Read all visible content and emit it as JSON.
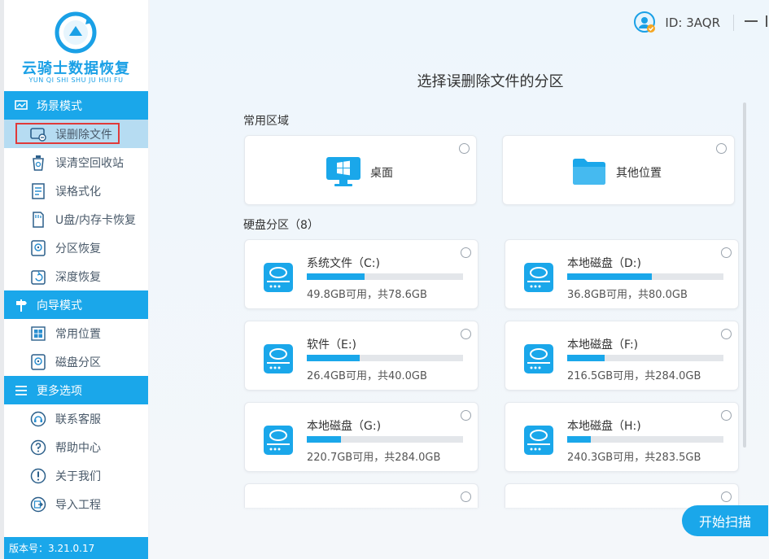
{
  "app": {
    "logo_cn": "云骑士数据恢复",
    "logo_en": "YUN QI SHI SHU JU HUI FU",
    "version": "版本号：3.21.0.17",
    "user_id": "ID: 3AQR"
  },
  "sidebar": {
    "sections": [
      {
        "title": "场景模式",
        "icon": "scene-mode-icon",
        "items": [
          {
            "label": "误删除文件",
            "icon": "deleted-file-icon",
            "active": true
          },
          {
            "label": "误清空回收站",
            "icon": "recycle-bin-icon"
          },
          {
            "label": "误格式化",
            "icon": "format-icon"
          },
          {
            "label": "U盘/内存卡恢复",
            "icon": "usb-card-icon"
          },
          {
            "label": "分区恢复",
            "icon": "partition-icon"
          },
          {
            "label": "深度恢复",
            "icon": "deep-recovery-icon"
          }
        ]
      },
      {
        "title": "向导模式",
        "icon": "guide-mode-icon",
        "items": [
          {
            "label": "常用位置",
            "icon": "windows-icon"
          },
          {
            "label": "磁盘分区",
            "icon": "disk-partition-icon"
          }
        ]
      },
      {
        "title": "更多选项",
        "icon": "menu-lines-icon",
        "items": [
          {
            "label": "联系客服",
            "icon": "headset-icon"
          },
          {
            "label": "帮助中心",
            "icon": "question-icon"
          },
          {
            "label": "关于我们",
            "icon": "info-icon"
          },
          {
            "label": "导入工程",
            "icon": "import-icon"
          }
        ]
      }
    ]
  },
  "main": {
    "title": "选择误删除文件的分区",
    "common_section": "常用区域",
    "common_locations": [
      {
        "label": "桌面",
        "icon": "desktop-windows-icon"
      },
      {
        "label": "其他位置",
        "icon": "folder-icon"
      }
    ],
    "disk_section": "硬盘分区（8）",
    "disks": [
      {
        "name": "系统文件（C:)",
        "size": "49.8GB可用，共78.6GB",
        "used_fraction": 0.37
      },
      {
        "name": "本地磁盘（D:)",
        "size": "36.8GB可用，共80.0GB",
        "used_fraction": 0.54
      },
      {
        "name": "软件（E:)",
        "size": "26.4GB可用，共40.0GB",
        "used_fraction": 0.34
      },
      {
        "name": "本地磁盘（F:)",
        "size": "216.5GB可用，共284.0GB",
        "used_fraction": 0.24
      },
      {
        "name": "本地磁盘（G:)",
        "size": "220.7GB可用，共284.0GB",
        "used_fraction": 0.22
      },
      {
        "name": "本地磁盘（H:)",
        "size": "240.3GB可用，共283.5GB",
        "used_fraction": 0.15
      }
    ],
    "start_button": "开始扫描"
  },
  "colors": {
    "accent": "#1aa7ea",
    "active_item_bg": "#b6dcf2",
    "highlight_outline": "#e03a3a"
  }
}
